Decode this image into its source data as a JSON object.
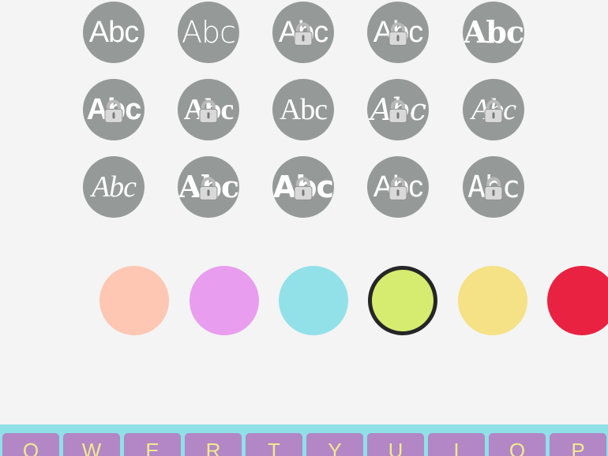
{
  "font_styles": [
    {
      "sample": "Abc",
      "font": "\"Liberation Sans\", sans-serif",
      "weight": "300",
      "style": "normal",
      "locked": false
    },
    {
      "sample": "Abc",
      "font": "\"DejaVu Sans\", sans-serif",
      "weight": "300",
      "style": "normal",
      "locked": false
    },
    {
      "sample": "Abc",
      "font": "\"Liberation Sans\", sans-serif",
      "weight": "300",
      "style": "normal",
      "locked": true
    },
    {
      "sample": "Abc",
      "font": "\"Liberation Sans\", sans-serif",
      "weight": "300",
      "style": "normal",
      "locked": true
    },
    {
      "sample": "Abc",
      "font": "\"DejaVu Serif\", serif",
      "weight": "bold",
      "style": "normal",
      "locked": false
    },
    {
      "sample": "Abc",
      "font": "\"Liberation Sans\", sans-serif",
      "weight": "bold",
      "style": "normal",
      "locked": true
    },
    {
      "sample": "Abc",
      "font": "\"Liberation Serif\", serif",
      "weight": "bold",
      "style": "normal",
      "locked": true
    },
    {
      "sample": "Abc",
      "font": "\"Liberation Serif\", serif",
      "weight": "normal",
      "style": "normal",
      "locked": false
    },
    {
      "sample": "Abc",
      "font": "\"DejaVu Serif\", serif",
      "weight": "normal",
      "style": "italic",
      "locked": true
    },
    {
      "sample": "Abc",
      "font": "\"Liberation Serif\", serif",
      "weight": "normal",
      "style": "italic",
      "locked": true
    },
    {
      "sample": "Abc",
      "font": "\"Liberation Serif\", serif",
      "weight": "normal",
      "style": "italic",
      "locked": false
    },
    {
      "sample": "Abc",
      "font": "\"DejaVu Serif\", serif",
      "weight": "bold",
      "style": "normal",
      "locked": true
    },
    {
      "sample": "Abc",
      "font": "\"DejaVu Sans\", sans-serif",
      "weight": "bold",
      "style": "normal",
      "locked": true
    },
    {
      "sample": "Abc",
      "font": "\"Liberation Sans\", sans-serif",
      "weight": "normal",
      "style": "normal",
      "locked": true
    },
    {
      "sample": "Abc",
      "font": "\"DejaVu Sans Mono\", monospace",
      "weight": "300",
      "style": "normal",
      "locked": true
    }
  ],
  "colors": [
    {
      "hex": "#fdc7b3",
      "selected": false
    },
    {
      "hex": "#e89def",
      "selected": false
    },
    {
      "hex": "#92e1e9",
      "selected": false
    },
    {
      "hex": "#d5ec71",
      "selected": true
    },
    {
      "hex": "#f5e186",
      "selected": false
    },
    {
      "hex": "#e92241",
      "selected": false
    }
  ],
  "keyboard": {
    "keys": [
      "Q",
      "W",
      "E",
      "R",
      "T",
      "Y",
      "U",
      "I",
      "O",
      "P"
    ],
    "background": "#8fe0e7",
    "key_color": "#b386c6",
    "key_text_color": "#f0ea8e"
  }
}
